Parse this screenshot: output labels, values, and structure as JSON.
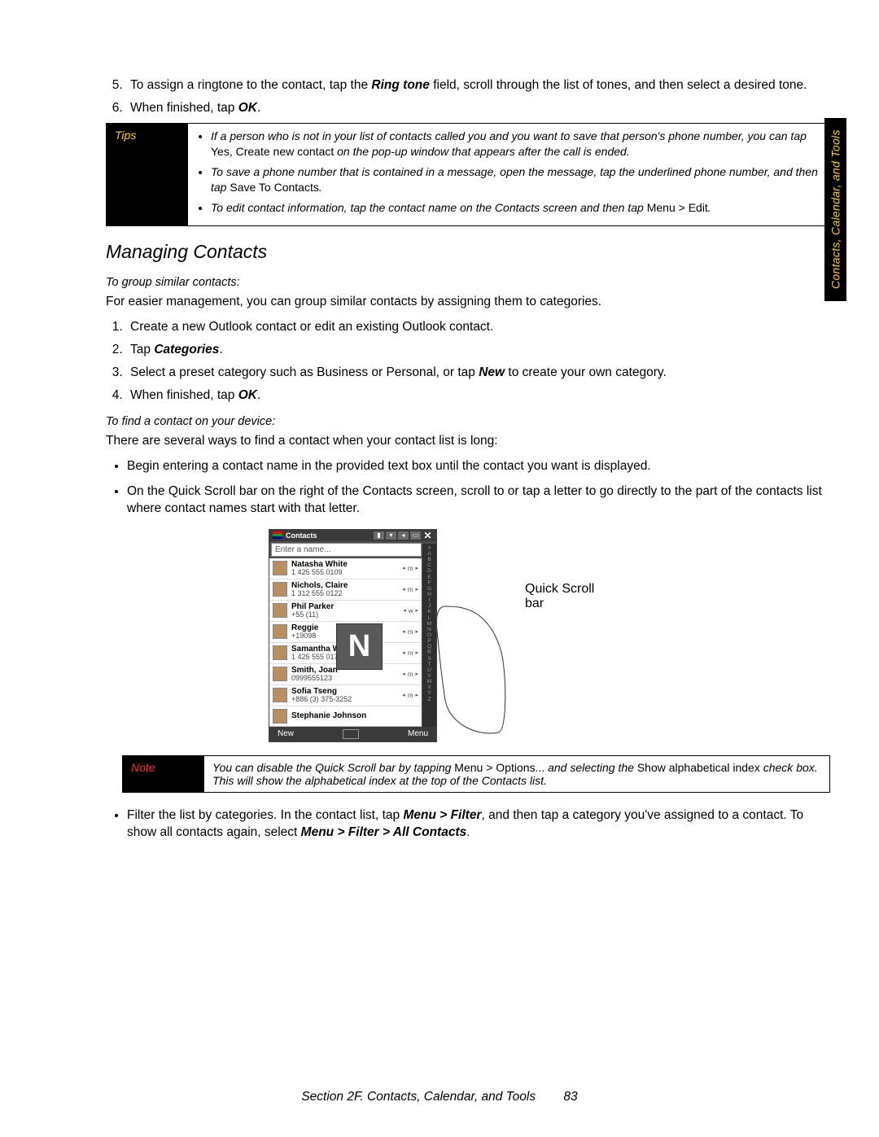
{
  "side_tab": "Contacts, Calendar, and Tools",
  "step5_pre": "To assign a ringtone to the contact, tap the ",
  "step5_field": "Ring tone",
  "step5_post": " field, scroll through the list of tones, and then select a desired tone.",
  "step6_pre": "When finished, tap ",
  "step6_ok": "OK",
  "step6_post": ".",
  "tips_label": "Tips",
  "tip1_a": "If a person who is not in your list of contacts called you and you want to save that person's phone number, you can tap ",
  "tip1_b": "Yes, Create new contact",
  "tip1_c": " on the pop-up window that appears after the call is ended.",
  "tip2_a": "To save a phone number that is contained in a message, open the message, tap the underlined phone number, and then tap ",
  "tip2_b": "Save To Contacts",
  "tip2_c": ".",
  "tip3_a": "To edit contact information, tap the contact name on the Contacts screen and then tap ",
  "tip3_b": "Menu > Edit",
  "tip3_c": ".",
  "managing_heading": "Managing Contacts",
  "group_sub": "To group similar contacts:",
  "group_intro": "For easier management, you can group similar contacts by assigning them to categories.",
  "g1": "Create a new Outlook contact or edit an existing Outlook contact.",
  "g2_pre": "Tap ",
  "g2_b": "Categories",
  "g2_post": ".",
  "g3_pre": "Select a preset category such as Business or Personal, or tap ",
  "g3_new": "New",
  "g3_post": " to create your own category.",
  "g4_pre": "When finished, tap ",
  "g4_ok": "OK",
  "g4_post": ".",
  "find_sub": "To find a contact on your device:",
  "find_intro": "There are several ways to find a contact when your contact list is long:",
  "b1": "Begin entering a contact name in the provided text box until the contact you want is displayed.",
  "b2": "On the Quick Scroll bar on the right of the Contacts screen, scroll to or tap a letter to go directly to the part of the contacts list where contact names start with that letter.",
  "callout_l1": "Quick Scroll",
  "callout_l2": "bar",
  "note_label": "Note",
  "note_a": "You can disable the Quick Scroll bar by tapping ",
  "note_b": "Menu > Options...",
  "note_c": " and selecting the ",
  "note_d": "Show alphabetical index",
  "note_e": " check box. This will show the alphabetical index at the top of the Contacts list.",
  "b3_pre": "Filter the list by categories. In the contact list, tap ",
  "b3_m1": "Menu > Filter",
  "b3_mid": ", and then tap a category you've assigned to a contact. To show all contacts again, select ",
  "b3_m2": "Menu > Filter > All Contacts",
  "b3_post": ".",
  "footer_sec": "Section 2F. Contacts, Calendar, and Tools",
  "footer_page": "83",
  "phone": {
    "title": "Contacts",
    "search_placeholder": "Enter a name...",
    "popup_letter": "N",
    "sk_left": "New",
    "sk_right": "Menu",
    "contacts": [
      {
        "name": "Natasha White",
        "num": "1 425 555 0109",
        "tag": "m"
      },
      {
        "name": "Nichols, Claire",
        "num": "1 312 555 0122",
        "tag": "m"
      },
      {
        "name": "Phil Parker",
        "num": "+55 (11)",
        "tag": "w"
      },
      {
        "name": "Reggie",
        "num": "+19098",
        "tag": "m"
      },
      {
        "name": "Samantha Watson",
        "num": "1 425 555 0177",
        "tag": "m"
      },
      {
        "name": "Smith, Joan",
        "num": "0999555123",
        "tag": "m"
      },
      {
        "name": "Sofia Tseng",
        "num": "+886 (3) 375-3252",
        "tag": "m"
      },
      {
        "name": "Stephanie Johnson",
        "num": "",
        "tag": ""
      }
    ],
    "qs": [
      "#",
      "A",
      "B",
      "C",
      "D",
      "E",
      "F",
      "G",
      "H",
      "I",
      "J",
      "K",
      "L",
      "M",
      "N",
      "O",
      "P",
      "Q",
      "R",
      "S",
      "T",
      "U",
      "V",
      "W",
      "X",
      "Y",
      "Z"
    ]
  }
}
